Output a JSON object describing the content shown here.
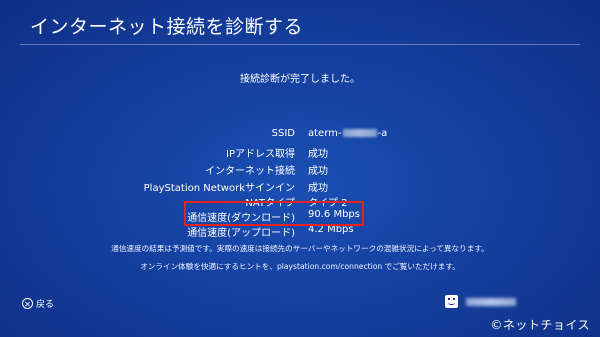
{
  "header": {
    "title": "インターネット接続を診断する"
  },
  "status": {
    "message": "接続診断が完了しました。"
  },
  "results": [
    {
      "label": "SSID",
      "value_prefix": "aterm-",
      "value_suffix": "-a"
    },
    {
      "label": "IPアドレス取得",
      "value": "成功"
    },
    {
      "label": "インターネット接続",
      "value": "成功"
    },
    {
      "label": "PlayStation Networkサインイン",
      "value": "成功"
    },
    {
      "label": "NATタイプ",
      "value": "タイプ 2"
    },
    {
      "label": "通信速度(ダウンロード)",
      "value": "90.6 Mbps"
    },
    {
      "label": "通信速度(アップロード)",
      "value": "4.2 Mbps"
    }
  ],
  "notes": {
    "line1": "通信速度の結果は予測値です。実際の速度は接続先のサーバーやネットワークの混雑状況によって異なります。",
    "line2": "オンライン体験を快適にするヒントを、playstation.com/connection でご覧いただけます。"
  },
  "footer": {
    "back_label": "戻る",
    "back_icon": "cross-button-icon",
    "avatar_icon": "smiley-avatar-icon"
  },
  "watermark": "©ネットチョイス",
  "colors": {
    "background": "#1540a0",
    "highlight": "#e8211d",
    "text": "#ffffff"
  }
}
